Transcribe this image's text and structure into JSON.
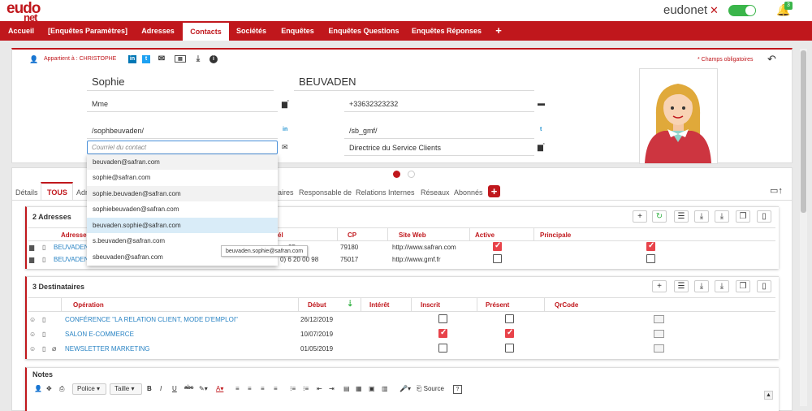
{
  "app": {
    "logo_top": "eudo",
    "logo_bottom": "net",
    "brand": "eudonet",
    "brand_mark": "✕",
    "notifications": "3",
    "accent": "#c0171c"
  },
  "nav": [
    {
      "label": "Accueil"
    },
    {
      "label": "[Enquêtes Paramètres]"
    },
    {
      "label": "Adresses"
    },
    {
      "label": "Contacts",
      "active": true
    },
    {
      "label": "Sociétés"
    },
    {
      "label": "Enquêtes"
    },
    {
      "label": "Enquêtes Questions"
    },
    {
      "label": "Enquêtes Réponses"
    },
    {
      "label": "+"
    }
  ],
  "contact": {
    "owner": "Appartient à : CHRISTOPHE",
    "required_note": "* Champs obligatoires",
    "first_name": "Sophie",
    "last_name": "BEUVADEN",
    "civility": "Mme",
    "phone": "+33632323232",
    "linkedin": "/sophbeuvaden/",
    "twitter": "/sb_gmf/",
    "email_placeholder": "Courriel du contact",
    "job_title": "Directrice du Service Clients"
  },
  "email_suggestions": [
    "beuvaden@safran.com",
    "sophie@safran.com",
    "sophie.beuvaden@safran.com",
    "sophiebeuvaden@safran.com",
    "beuvaden.sophie@safran.com",
    "s.beuvaden@safran.com",
    "sbeuvaden@safran.com"
  ],
  "tooltip": "beuvaden.sophie@safran.com",
  "tabs": [
    "Détails",
    "TOUS",
    "Adr",
    "aires",
    "Responsable de",
    "Relations Internes",
    "Réseaux",
    "Abonnés"
  ],
  "adresses": {
    "title": "2 Adresses",
    "headers": [
      "Adresse",
      "él",
      "CP",
      "Site Web",
      "Active",
      "Principale"
    ],
    "rows": [
      {
        "name": "BEUVADEN",
        "tel": "35",
        "cp": "79180",
        "web": "http://www.safran.com",
        "active": true,
        "principale": true
      },
      {
        "name": "BEUVADEN",
        "tel": "0) 6 20 00 98",
        "cp": "75017",
        "web": "http://www.gmf.fr",
        "active": false,
        "principale": false
      }
    ]
  },
  "destinataires": {
    "title": "3 Destinataires",
    "headers": [
      "Opération",
      "Début",
      "Intérêt",
      "Inscrit",
      "Présent",
      "QrCode"
    ],
    "rows": [
      {
        "op": "CONFÉRENCE \"LA RELATION CLIENT, MODE D'EMPLOI\"",
        "date": "26/12/2019",
        "inscrit": false,
        "present": false
      },
      {
        "op": "SALON E-COMMERCE",
        "date": "10/07/2019",
        "inscrit": true,
        "present": true
      },
      {
        "op": "NEWSLETTER MARKETING",
        "date": "01/05/2019",
        "inscrit": false,
        "present": false
      }
    ]
  },
  "notes": {
    "title": "Notes",
    "font_label": "Police",
    "size_label": "Taille",
    "source_label": "Source",
    "help_label": "?"
  }
}
